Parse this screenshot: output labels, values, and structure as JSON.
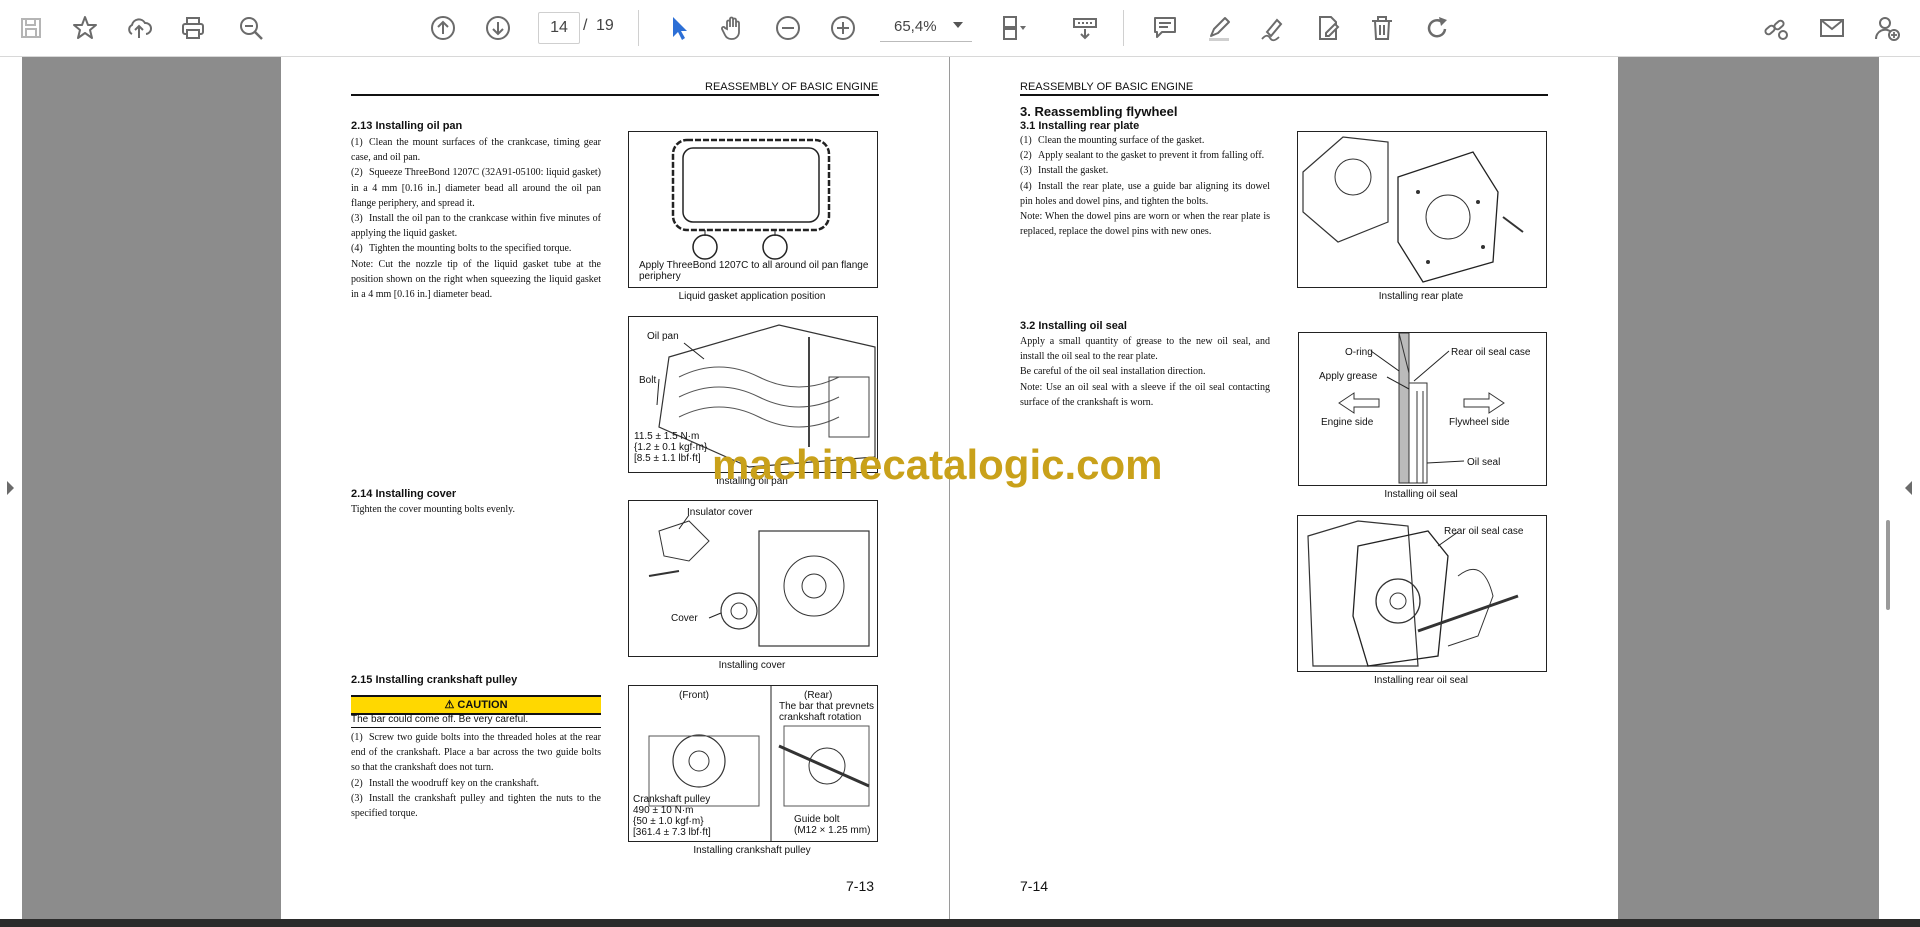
{
  "toolbar": {
    "current_page": "14",
    "page_separator": "/",
    "total_pages": "19",
    "zoom": "65,4%"
  },
  "colors": {
    "accent_blue": "#2c6fd6",
    "icon_gray": "#6b6b6b",
    "caution_yellow": "#ffd800",
    "watermark": "#c9a11a"
  },
  "left_page": {
    "header": "REASSEMBLY OF BASIC ENGINE",
    "s213": {
      "title": "2.13 Installing oil pan",
      "items": [
        {
          "num": "(1)",
          "text": "Clean the mount surfaces of the crankcase, timing gear case, and oil pan."
        },
        {
          "num": "(2)",
          "text": "Squeeze ThreeBond 1207C (32A91-05100: liquid gasket) in a 4 mm [0.16 in.] diameter bead all around the oil pan flange periphery, and spread it."
        },
        {
          "num": "(3)",
          "text": "Install the oil pan to the crankcase within five minutes of applying the liquid gasket."
        },
        {
          "num": "(4)",
          "text": "Tighten the mounting bolts to the specified torque."
        }
      ],
      "note": "Note: Cut the nozzle tip of the liquid gasket tube at the position shown on the right when squeezing the liquid gasket in a 4 mm [0.16 in.] diameter bead.",
      "fig1_label": "Apply ThreeBond 1207C to all around oil pan flange periphery",
      "fig1_caption": "Liquid gasket application position",
      "fig2_oilpan": "Oil pan",
      "fig2_bolt": "Bolt",
      "fig2_torque": "11.5 ± 1.5 N·m\n{1.2 ± 0.1 kgf·m}\n[8.5 ± 1.1 lbf·ft]",
      "fig2_caption": "Installing oil pan"
    },
    "s214": {
      "title": "2.14 Installing cover",
      "text": "Tighten the cover mounting bolts evenly.",
      "fig_insulator": "Insulator cover",
      "fig_cover": "Cover",
      "fig_caption": "Installing cover"
    },
    "s215": {
      "title": "2.15 Installing crankshaft pulley",
      "caution": "CAUTION",
      "caution_text": "The bar could come off. Be very careful.",
      "items": [
        {
          "num": "(1)",
          "text": "Screw two guide bolts into the threaded holes at the rear end of the crankshaft. Place a bar across the two guide bolts so that the crankshaft does not turn."
        },
        {
          "num": "(2)",
          "text": "Install the woodruff key on the crankshaft."
        },
        {
          "num": "(3)",
          "text": "Install the crankshaft pulley and tighten the nuts to the specified torque."
        }
      ],
      "fig_front": "(Front)",
      "fig_rear": "(Rear)",
      "fig_bar": "The bar that prevnets\ncrankshaft rotation",
      "fig_pulley": "Crankshaft pulley\n490 ± 10 N·m\n{50 ± 1.0 kgf·m}\n[361.4 ± 7.3 lbf·ft]",
      "fig_guide": "Guide bolt\n(M12 × 1.25 mm)",
      "fig_caption": "Installing crankshaft pulley"
    },
    "page_number": "7-13"
  },
  "right_page": {
    "header": "REASSEMBLY OF BASIC ENGINE",
    "section_title": "3. Reassembling flywheel",
    "s31": {
      "title": "3.1   Installing rear plate",
      "items": [
        {
          "num": "(1)",
          "text": "Clean the mounting surface of the gasket."
        },
        {
          "num": "(2)",
          "text": "Apply sealant to the gasket to prevent it from falling off."
        },
        {
          "num": "(3)",
          "text": "Install the gasket."
        },
        {
          "num": "(4)",
          "text": "Install the rear plate, use a guide bar aligning its dowel pin holes and dowel pins, and tighten the bolts."
        }
      ],
      "note": "Note: When the dowel pins are worn or when the rear plate is replaced, replace the dowel pins with new ones.",
      "fig_caption": "Installing rear plate"
    },
    "s32": {
      "title": "3.2   Installing oil seal",
      "lines": [
        "Apply a small quantity of grease to the new oil seal, and install the oil seal to the rear plate.",
        "Be careful of the oil seal installation direction."
      ],
      "note": "Note: Use an oil seal with a sleeve if the oil seal contacting surface of the crankshaft is worn.",
      "fig_oring": "O-ring",
      "fig_case": "Rear oil seal case",
      "fig_grease": "Apply grease",
      "fig_engine": "Engine side",
      "fig_flywheel": "Flywheel side",
      "fig_seal": "Oil seal",
      "fig_caption": "Installing oil seal",
      "fig2_case": "Rear oil seal case",
      "fig2_caption": "Installing rear oil seal"
    },
    "page_number": "7-14"
  },
  "watermark": "machinecatalogic.com"
}
